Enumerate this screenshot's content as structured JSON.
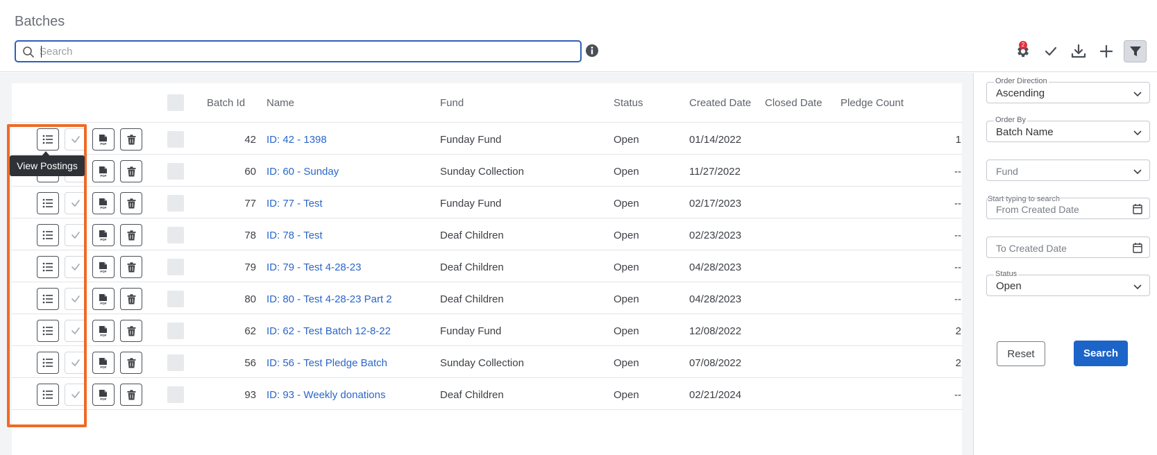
{
  "header": {
    "title": "Batches",
    "search_placeholder": "Search",
    "notification_count": "2",
    "icons": [
      "search-icon",
      "info-icon",
      "gear-icon",
      "check-icon",
      "download-icon",
      "plus-icon",
      "filter-icon"
    ]
  },
  "table": {
    "columns": [
      "Batch Id",
      "Name",
      "Fund",
      "Status",
      "Created Date",
      "Closed Date",
      "Pledge Count"
    ],
    "rows": [
      {
        "id": "42",
        "name": "ID: 42 - 1398",
        "fund": "Funday Fund",
        "status": "Open",
        "created": "01/14/2022",
        "closed": "",
        "pledge": "1"
      },
      {
        "id": "60",
        "name": "ID: 60 - Sunday",
        "fund": "Sunday Collection",
        "status": "Open",
        "created": "11/27/2022",
        "closed": "",
        "pledge": "--"
      },
      {
        "id": "77",
        "name": "ID: 77 - Test",
        "fund": "Funday Fund",
        "status": "Open",
        "created": "02/17/2023",
        "closed": "",
        "pledge": "--"
      },
      {
        "id": "78",
        "name": "ID: 78 - Test",
        "fund": "Deaf Children",
        "status": "Open",
        "created": "02/23/2023",
        "closed": "",
        "pledge": "--"
      },
      {
        "id": "79",
        "name": "ID: 79 - Test 4-28-23",
        "fund": "Deaf Children",
        "status": "Open",
        "created": "04/28/2023",
        "closed": "",
        "pledge": "--"
      },
      {
        "id": "80",
        "name": "ID: 80 - Test 4-28-23 Part 2",
        "fund": "Deaf Children",
        "status": "Open",
        "created": "04/28/2023",
        "closed": "",
        "pledge": "--"
      },
      {
        "id": "62",
        "name": "ID: 62 - Test Batch 12-8-22",
        "fund": "Funday Fund",
        "status": "Open",
        "created": "12/08/2022",
        "closed": "",
        "pledge": "2"
      },
      {
        "id": "56",
        "name": "ID: 56 - Test Pledge Batch",
        "fund": "Sunday Collection",
        "status": "Open",
        "created": "07/08/2022",
        "closed": "",
        "pledge": "2"
      },
      {
        "id": "93",
        "name": "ID: 93 - Weekly donations",
        "fund": "Deaf Children",
        "status": "Open",
        "created": "02/21/2024",
        "closed": "",
        "pledge": "--"
      }
    ],
    "row_actions": [
      "list-icon",
      "check-icon",
      "pdf-icon",
      "trash-icon"
    ]
  },
  "tooltip": {
    "text": "View Postings"
  },
  "filters": {
    "order_direction": {
      "label": "Order Direction",
      "value": "Ascending"
    },
    "order_by": {
      "label": "Order By",
      "value": "Batch Name"
    },
    "fund": {
      "placeholder": "Fund",
      "helper": "Start typing to search"
    },
    "from_date": {
      "placeholder": "From Created Date"
    },
    "to_date": {
      "placeholder": "To Created Date"
    },
    "status": {
      "label": "Status",
      "value": "Open"
    },
    "reset_label": "Reset",
    "search_label": "Search"
  },
  "colors": {
    "accent": "#1d64c8",
    "link": "#2a66c9",
    "highlight": "#f06a25",
    "badge": "#e2303a"
  }
}
